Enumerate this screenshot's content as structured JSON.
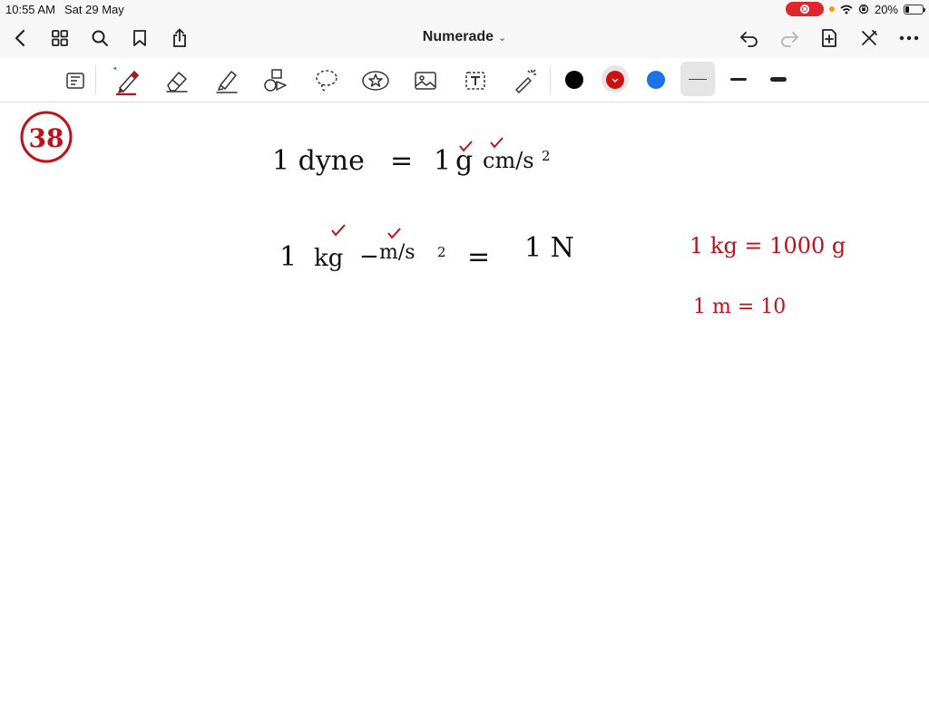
{
  "status_bar": {
    "time": "10:55 AM",
    "date": "Sat 29 May",
    "battery": "20%",
    "battery_level_percent": 20
  },
  "nav": {
    "title": "Numerade",
    "title_chevron": "⌄"
  },
  "toolbar": {
    "tools": [
      "reader-mode-icon",
      "pen-icon",
      "eraser-icon",
      "highlighter-icon",
      "shapes-icon",
      "lasso-icon",
      "sticker-icon",
      "image-icon",
      "text-icon",
      "laser-pointer-icon"
    ],
    "colors": [
      "#000000",
      "#cc1111",
      "#1a73e8"
    ],
    "selected_color": "#cc1111",
    "selected_thickness": 1
  },
  "notes": {
    "problem_number": "38",
    "line1_left": "1 dyne",
    "line1_eq": "=",
    "line1_right": "1 g cm/s²",
    "line1_one": "1",
    "line1_g": "g",
    "line1_cm": "cm/s",
    "line1_exp": "2",
    "line2_left": "1",
    "line2_kg": "kg",
    "line2_dash": "−",
    "line2_m": "m/s",
    "line2_exp": "2",
    "line2_eq": "=",
    "line2_right": "1 N",
    "side1": "1 kg = 1000 g",
    "side2": "1 m = 10"
  },
  "colors": {
    "ink": "#111111",
    "red_ink": "#c0101a"
  }
}
